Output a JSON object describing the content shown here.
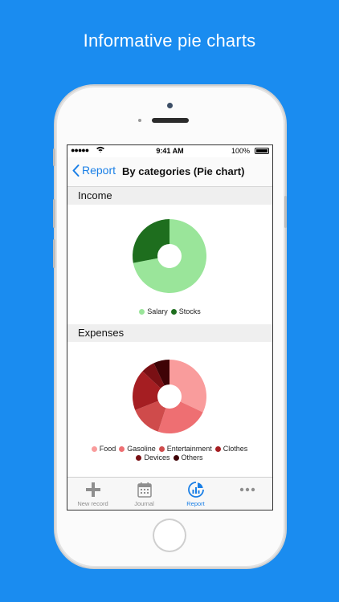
{
  "promo": {
    "headline": "Informative pie charts"
  },
  "status_bar": {
    "signal": "●●●●●",
    "time": "9:41 AM",
    "battery": "100%"
  },
  "nav": {
    "back_label": "Report",
    "title": "By categories (Pie chart)"
  },
  "sections": [
    {
      "title": "Income",
      "chart_data": {
        "type": "pie",
        "donut": true,
        "title": "Income",
        "slices": [
          {
            "label": "Salary",
            "value": 72,
            "color": "#9ae59a"
          },
          {
            "label": "Stocks",
            "value": 28,
            "color": "#1e6e1e"
          }
        ]
      }
    },
    {
      "title": "Expenses",
      "chart_data": {
        "type": "pie",
        "donut": true,
        "title": "Expenses",
        "slices": [
          {
            "label": "Food",
            "value": 32,
            "color": "#f99c9c"
          },
          {
            "label": "Gasoline",
            "value": 23,
            "color": "#ee6f72"
          },
          {
            "label": "Entertainment",
            "value": 14,
            "color": "#cf4b4b"
          },
          {
            "label": "Clothes",
            "value": 18,
            "color": "#a51e22"
          },
          {
            "label": "Devices",
            "value": 6,
            "color": "#7a1014"
          },
          {
            "label": "Others",
            "value": 7,
            "color": "#3f0306"
          }
        ]
      }
    }
  ],
  "tabs": [
    {
      "label": "New record",
      "icon": "plus-icon",
      "active": false
    },
    {
      "label": "Journal",
      "icon": "calendar-icon",
      "active": false
    },
    {
      "label": "Report",
      "icon": "report-chart-icon",
      "active": true
    },
    {
      "label": "",
      "icon": "more-icon",
      "active": false
    }
  ],
  "colors": {
    "accent": "#1a7fe6",
    "background": "#1a8cf0"
  }
}
